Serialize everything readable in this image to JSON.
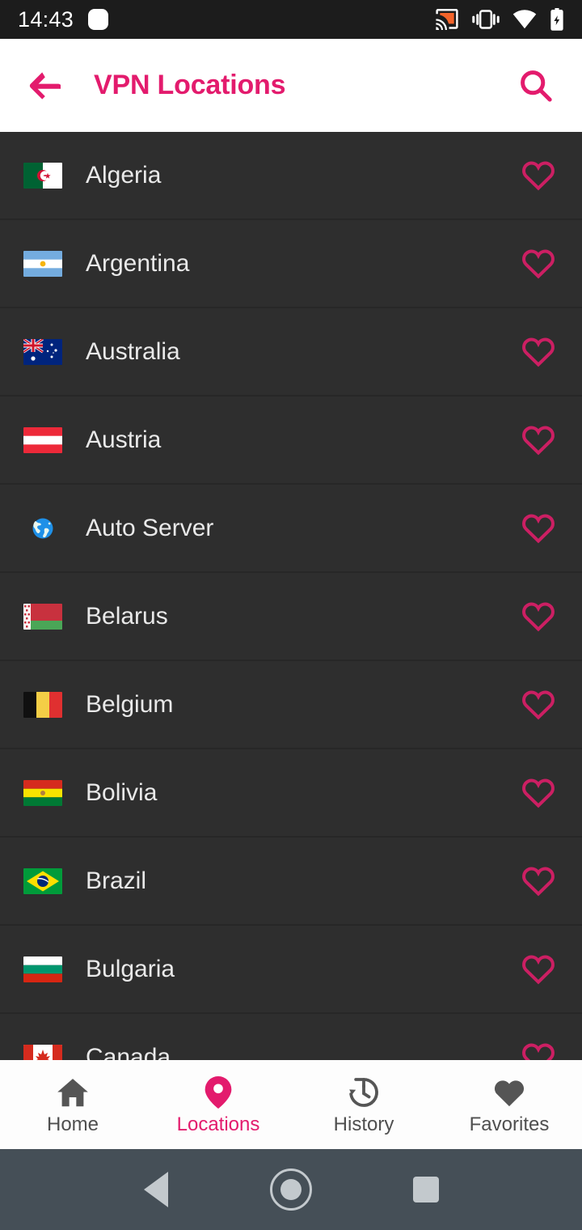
{
  "status_bar": {
    "time": "14:43",
    "icons": [
      "notification-dot",
      "cast-icon",
      "vibrate-icon",
      "wifi-icon",
      "battery-charging-icon"
    ],
    "background_color": "#1c1c1c",
    "cast_icon_color": "#f4642a"
  },
  "app_bar": {
    "back_label": "Back",
    "title": "VPN Locations",
    "search_label": "Search",
    "accent_color": "#e31b6d",
    "background_color": "#ffffff"
  },
  "list": {
    "background_color": "#2e2e2e",
    "divider_color": "#272727",
    "text_color": "#e9e9e9",
    "favorite_color": "#e31b6d",
    "items": [
      {
        "name": "Algeria",
        "flag": "algeria-flag",
        "favorite": false
      },
      {
        "name": "Argentina",
        "flag": "argentina-flag",
        "favorite": false
      },
      {
        "name": "Australia",
        "flag": "australia-flag",
        "favorite": false
      },
      {
        "name": "Austria",
        "flag": "austria-flag",
        "favorite": false
      },
      {
        "name": "Auto Server",
        "flag": "globe-icon",
        "favorite": false
      },
      {
        "name": "Belarus",
        "flag": "belarus-flag",
        "favorite": false
      },
      {
        "name": "Belgium",
        "flag": "belgium-flag",
        "favorite": false
      },
      {
        "name": "Bolivia",
        "flag": "bolivia-flag",
        "favorite": false
      },
      {
        "name": "Brazil",
        "flag": "brazil-flag",
        "favorite": false
      },
      {
        "name": "Bulgaria",
        "flag": "bulgaria-flag",
        "favorite": false
      },
      {
        "name": "Canada",
        "flag": "canada-flag",
        "favorite": false
      }
    ]
  },
  "bottom_nav": {
    "background_color": "#fdfdfd",
    "active_color": "#e31b6d",
    "inactive_color": "#4f4f4f",
    "items": [
      {
        "label": "Home",
        "icon": "home-icon",
        "active": false
      },
      {
        "label": "Locations",
        "icon": "location-pin-icon",
        "active": true
      },
      {
        "label": "History",
        "icon": "history-clock-icon",
        "active": false
      },
      {
        "label": "Favorites",
        "icon": "heart-filled-icon",
        "active": false
      }
    ]
  },
  "android_nav": {
    "background_color": "#454f57",
    "back_label": "Back",
    "home_label": "Home",
    "recents_label": "Recents"
  }
}
